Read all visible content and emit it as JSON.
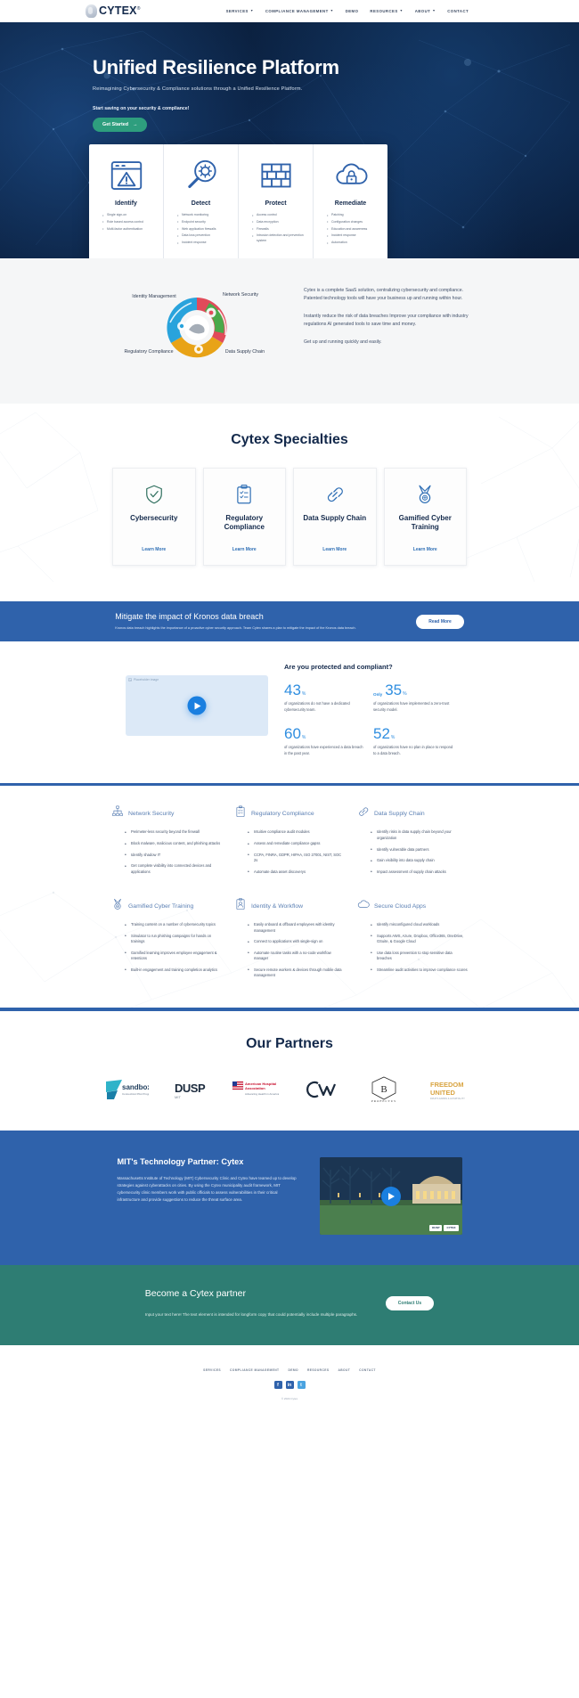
{
  "nav": {
    "brand": "CYTEX",
    "brand_tm": "®",
    "links": [
      {
        "label": "SERVICES",
        "caret": "▼"
      },
      {
        "label": "COMPLIANCE MANAGEMENT",
        "caret": "▼"
      },
      {
        "label": "DEMO",
        "caret": ""
      },
      {
        "label": "RESOURCES",
        "caret": "▼"
      },
      {
        "label": "ABOUT",
        "caret": "▼"
      },
      {
        "label": "CONTACT",
        "caret": ""
      }
    ]
  },
  "hero": {
    "title": "Unified Resilience Platform",
    "subtitle": "Reimagining Cybersecurity & Compliance solutions through a Unified Resilience Platform.",
    "kicker": "Start saving on your security & compliance!",
    "cta": "Get Started",
    "cta_arrow": "→",
    "cards": [
      {
        "title": "Identify",
        "icon": "browser-warning-icon",
        "items": [
          "Single sign-on",
          "Role based access control",
          "Multi-factor authentication"
        ]
      },
      {
        "title": "Detect",
        "icon": "magnifier-bug-icon",
        "items": [
          "Network monitoring",
          "Endpoint security",
          "Web application firewalls",
          "Data loss prevention",
          "Incident response"
        ]
      },
      {
        "title": "Protect",
        "icon": "firewall-brick-icon",
        "items": [
          "Access control",
          "Data encryption",
          "Firewalls",
          "Intrusion detection and prevention system"
        ]
      },
      {
        "title": "Remediate",
        "icon": "cloud-lock-icon",
        "items": [
          "Patching",
          "Configuration changes",
          "Education and awareness",
          "Incident response",
          "Automation"
        ]
      }
    ]
  },
  "saas": {
    "wheel_labels": [
      {
        "label": "Identity Management",
        "color": "#29a3dc"
      },
      {
        "label": "Network Security",
        "color": "#e14b5a"
      },
      {
        "label": "Regulatory Compliance",
        "color": "#e8a317"
      },
      {
        "label": "Data Supply Chain",
        "color": "#4aa94a"
      }
    ],
    "paragraphs": [
      "Cytex is a complete SaaS solution, centralizing cybersecurity and compliance. Patented technology tools will have your business up and running within hour.",
      "Instantly reduce the risk of data breaches Improve your compliance with industry regulations AI generated tools to save time and money.",
      "Get up and running quickly and easily."
    ]
  },
  "specialties": {
    "title": "Cytex Specialties",
    "cards": [
      {
        "title": "Cybersecurity",
        "icon": "shield-check-icon",
        "link": "Learn More",
        "accent": "#2f6f5e"
      },
      {
        "title": "Regulatory Compliance",
        "icon": "clipboard-check-icon",
        "link": "Learn More",
        "accent": "#2f6fb5"
      },
      {
        "title": "Data Supply Chain",
        "icon": "chain-link-icon",
        "link": "Learn More",
        "accent": "#2f6fb5"
      },
      {
        "title": "Gamified Cyber Training",
        "icon": "medal-icon",
        "link": "Learn More",
        "accent": "#2f6fb5"
      }
    ]
  },
  "kronos": {
    "title": "Mitigate the impact of Kronos data breach",
    "body": "Kronos data breach highlights the importance of a proactive cyber security approach. Team Cytex shares a plan to mitigate the impact of the Kronos data breach.",
    "cta": "Read More"
  },
  "stats": {
    "heading": "Are you protected and compliant?",
    "video_placeholder": "Placeholder image",
    "items": [
      {
        "prefix": "",
        "value": "43",
        "unit": "%",
        "desc": "of organizations do not have a dedicated cybersecurity team."
      },
      {
        "prefix": "Only",
        "value": "35",
        "unit": "%",
        "desc": "of organizations have implemented a zero-trust security model."
      },
      {
        "prefix": "",
        "value": "60",
        "unit": "%",
        "desc": "of organizations have experienced a data breach in the past year."
      },
      {
        "prefix": "",
        "value": "52",
        "unit": "%",
        "desc": "of organizations have no plan in place to respond to a data breach."
      }
    ]
  },
  "features": [
    {
      "title": "Network Security",
      "icon": "network-nodes-icon",
      "items": [
        "Perimeter-less security beyond the firewall",
        "Block malware, malicious content, and phishing attacks",
        "Identify shadow IT",
        "Get complete visibility into connected devices and applications"
      ]
    },
    {
      "title": "Regulatory Compliance",
      "icon": "clipboard-check-icon",
      "items": [
        "Intuitive compliance audit modules",
        "Assess and remediate compliance gapss",
        "CCPA, FINRA, GDPR, HIPAA, ISO 27001, NIST, SOC 2s",
        "Automate data asset discoverys"
      ]
    },
    {
      "title": "Data Supply Chain",
      "icon": "chain-link-icon",
      "items": [
        "Identify risks in data supply chain beyond your organization",
        "Identify vulnerable data partners",
        "Gain visibility into data supply chain",
        "Impact assessment of supply chain attacks"
      ]
    },
    {
      "title": "Gamified Cyber Training",
      "icon": "medal-icon",
      "items": [
        "Training content on a number of cybersecurity topics",
        "Simulator to run phishing campaigns for hands on trainings",
        "Gamified learning improves employee engagement & retentions",
        "Built-in engagement and training completion analytics"
      ]
    },
    {
      "title": "Identity & Workflow",
      "icon": "id-badge-icon",
      "items": [
        "Easily onboard & offboard employees with identity management",
        "Connect to applications with single-sign on",
        "Automate routine tasks with a no-code workflow manager",
        "Secure remote workers & devices through mobile data management"
      ]
    },
    {
      "title": "Secure Cloud Apps",
      "icon": "cloud-icon",
      "items": [
        "Identify misconfigured cloud workloads",
        "Supports AWS, Azure, Dropbox, Office365, OneDrive, GSuite, & Google Cloud",
        "Use data loss prevention to stop sensitive data breaches",
        "Streamline audit activities to improve compliance scores"
      ]
    }
  ],
  "partners": {
    "title": "Our Partners",
    "logos": [
      {
        "name": "sandbox",
        "text": "sandbox",
        "sub": "Connecticut Pilot Program"
      },
      {
        "name": "dusp-mit",
        "text": "DUSP",
        "sub": "MIT"
      },
      {
        "name": "american-hospital-association",
        "text": "American Hospital Association",
        "sub": "Advancing Health in America"
      },
      {
        "name": "cw",
        "text": "CW",
        "sub": ""
      },
      {
        "name": "profectus-realty",
        "text": "B",
        "sub": "PROFECTUS REALTY"
      },
      {
        "name": "freedom-united",
        "text": "FREEDOM UNITED",
        "sub": "FRUITS FARMS & HOSPITALITY"
      }
    ]
  },
  "mit": {
    "title": "MIT's Technology Partner: Cytex",
    "body": "Massachusetts Institute of Technology (MIT) Cybersecurity Clinic and Cytex have teamed up to develop strategies against cyberattacks on cities. By using the Cytex municipality audit framework, MIT cybersecurity clinic members work with public officials to assess vulnerabilities in their critical infrastructure and provide suggestions to reduce the threat surface area.",
    "chips": [
      "DUSP",
      "CYTEX"
    ]
  },
  "become": {
    "title": "Become a Cytex partner",
    "body": "Input your text here! The text element is intended for longform copy that could potentially include multiple paragraphs.",
    "cta": "Contact Us"
  },
  "footer": {
    "links": [
      "SERVICES",
      "COMPLIANCE MANAGEMENT",
      "DEMO",
      "RESOURCES",
      "ABOUT",
      "CONTACT"
    ],
    "socials": [
      {
        "name": "facebook-icon",
        "glyph": "f",
        "color": "#2f62ab"
      },
      {
        "name": "linkedin-icon",
        "glyph": "in",
        "color": "#2f62ab"
      },
      {
        "name": "twitter-icon",
        "glyph": "t",
        "color": "#4aa3e0"
      }
    ],
    "copyright": "© 2024 Cytex"
  }
}
